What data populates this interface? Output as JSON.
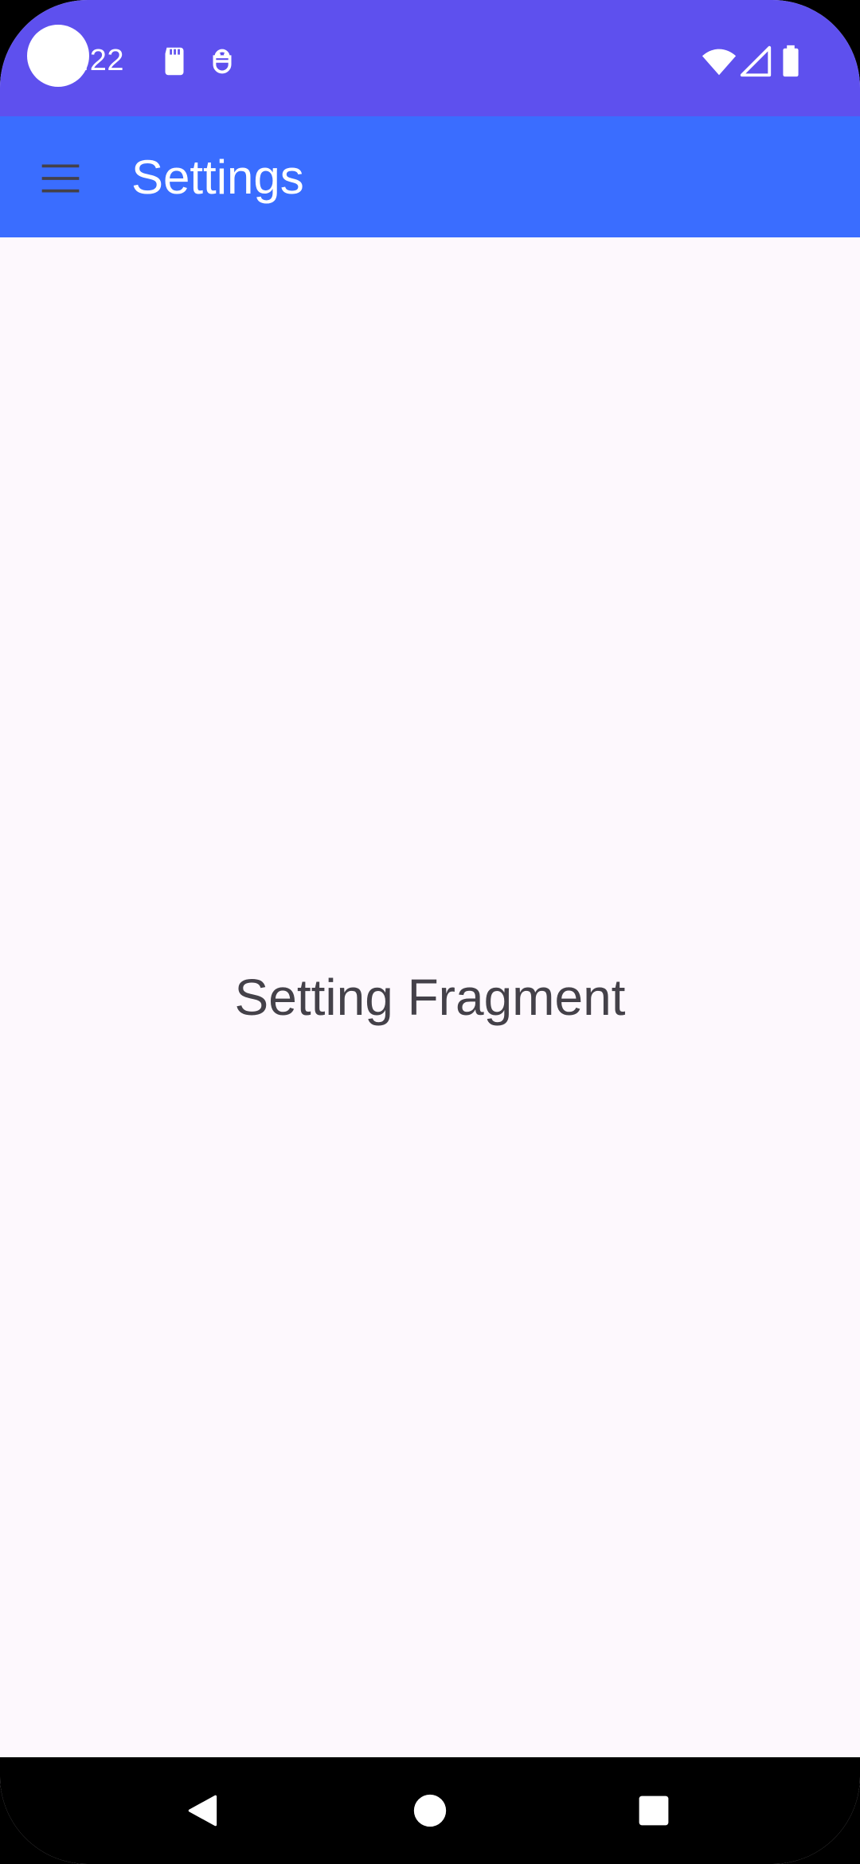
{
  "status_bar": {
    "time": "0:22",
    "icons": [
      "sd-card-icon",
      "debug-icon",
      "wifi-icon",
      "signal-icon",
      "battery-icon"
    ],
    "background": "#5E50EE"
  },
  "app_bar": {
    "title": "Settings",
    "menu_icon": "hamburger-menu-icon",
    "background": "#3A6DFF"
  },
  "content": {
    "text": "Setting Fragment",
    "background": "#FDF8FD",
    "text_color": "#444149"
  },
  "nav_bar": {
    "buttons": [
      "back-icon",
      "home-icon",
      "recents-icon"
    ],
    "background": "#000000"
  }
}
